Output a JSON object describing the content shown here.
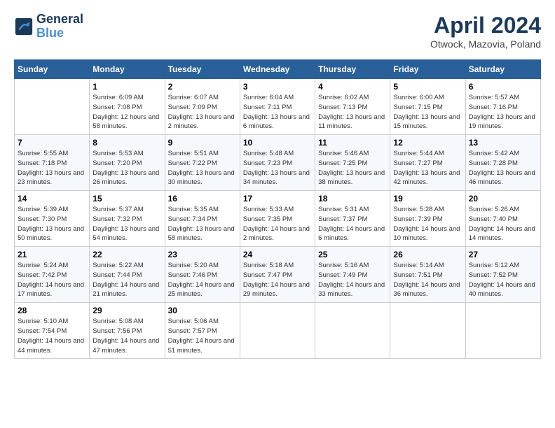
{
  "header": {
    "logo_line1": "General",
    "logo_line2": "Blue",
    "month": "April 2024",
    "location": "Otwock, Mazovia, Poland"
  },
  "days_of_week": [
    "Sunday",
    "Monday",
    "Tuesday",
    "Wednesday",
    "Thursday",
    "Friday",
    "Saturday"
  ],
  "weeks": [
    [
      {
        "day": "",
        "sunrise": "",
        "sunset": "",
        "daylight": ""
      },
      {
        "day": "1",
        "sunrise": "6:09 AM",
        "sunset": "7:08 PM",
        "daylight": "12 hours and 58 minutes."
      },
      {
        "day": "2",
        "sunrise": "6:07 AM",
        "sunset": "7:09 PM",
        "daylight": "13 hours and 2 minutes."
      },
      {
        "day": "3",
        "sunrise": "6:04 AM",
        "sunset": "7:11 PM",
        "daylight": "13 hours and 6 minutes."
      },
      {
        "day": "4",
        "sunrise": "6:02 AM",
        "sunset": "7:13 PM",
        "daylight": "13 hours and 11 minutes."
      },
      {
        "day": "5",
        "sunrise": "6:00 AM",
        "sunset": "7:15 PM",
        "daylight": "13 hours and 15 minutes."
      },
      {
        "day": "6",
        "sunrise": "5:57 AM",
        "sunset": "7:16 PM",
        "daylight": "13 hours and 19 minutes."
      }
    ],
    [
      {
        "day": "7",
        "sunrise": "5:55 AM",
        "sunset": "7:18 PM",
        "daylight": "13 hours and 23 minutes."
      },
      {
        "day": "8",
        "sunrise": "5:53 AM",
        "sunset": "7:20 PM",
        "daylight": "13 hours and 26 minutes."
      },
      {
        "day": "9",
        "sunrise": "5:51 AM",
        "sunset": "7:22 PM",
        "daylight": "13 hours and 30 minutes."
      },
      {
        "day": "10",
        "sunrise": "5:48 AM",
        "sunset": "7:23 PM",
        "daylight": "13 hours and 34 minutes."
      },
      {
        "day": "11",
        "sunrise": "5:46 AM",
        "sunset": "7:25 PM",
        "daylight": "13 hours and 38 minutes."
      },
      {
        "day": "12",
        "sunrise": "5:44 AM",
        "sunset": "7:27 PM",
        "daylight": "13 hours and 42 minutes."
      },
      {
        "day": "13",
        "sunrise": "5:42 AM",
        "sunset": "7:28 PM",
        "daylight": "13 hours and 46 minutes."
      }
    ],
    [
      {
        "day": "14",
        "sunrise": "5:39 AM",
        "sunset": "7:30 PM",
        "daylight": "13 hours and 50 minutes."
      },
      {
        "day": "15",
        "sunrise": "5:37 AM",
        "sunset": "7:32 PM",
        "daylight": "13 hours and 54 minutes."
      },
      {
        "day": "16",
        "sunrise": "5:35 AM",
        "sunset": "7:34 PM",
        "daylight": "13 hours and 58 minutes."
      },
      {
        "day": "17",
        "sunrise": "5:33 AM",
        "sunset": "7:35 PM",
        "daylight": "14 hours and 2 minutes."
      },
      {
        "day": "18",
        "sunrise": "5:31 AM",
        "sunset": "7:37 PM",
        "daylight": "14 hours and 6 minutes."
      },
      {
        "day": "19",
        "sunrise": "5:28 AM",
        "sunset": "7:39 PM",
        "daylight": "14 hours and 10 minutes."
      },
      {
        "day": "20",
        "sunrise": "5:26 AM",
        "sunset": "7:40 PM",
        "daylight": "14 hours and 14 minutes."
      }
    ],
    [
      {
        "day": "21",
        "sunrise": "5:24 AM",
        "sunset": "7:42 PM",
        "daylight": "14 hours and 17 minutes."
      },
      {
        "day": "22",
        "sunrise": "5:22 AM",
        "sunset": "7:44 PM",
        "daylight": "14 hours and 21 minutes."
      },
      {
        "day": "23",
        "sunrise": "5:20 AM",
        "sunset": "7:46 PM",
        "daylight": "14 hours and 25 minutes."
      },
      {
        "day": "24",
        "sunrise": "5:18 AM",
        "sunset": "7:47 PM",
        "daylight": "14 hours and 29 minutes."
      },
      {
        "day": "25",
        "sunrise": "5:16 AM",
        "sunset": "7:49 PM",
        "daylight": "14 hours and 33 minutes."
      },
      {
        "day": "26",
        "sunrise": "5:14 AM",
        "sunset": "7:51 PM",
        "daylight": "14 hours and 36 minutes."
      },
      {
        "day": "27",
        "sunrise": "5:12 AM",
        "sunset": "7:52 PM",
        "daylight": "14 hours and 40 minutes."
      }
    ],
    [
      {
        "day": "28",
        "sunrise": "5:10 AM",
        "sunset": "7:54 PM",
        "daylight": "14 hours and 44 minutes."
      },
      {
        "day": "29",
        "sunrise": "5:08 AM",
        "sunset": "7:56 PM",
        "daylight": "14 hours and 47 minutes."
      },
      {
        "day": "30",
        "sunrise": "5:06 AM",
        "sunset": "7:57 PM",
        "daylight": "14 hours and 51 minutes."
      },
      {
        "day": "",
        "sunrise": "",
        "sunset": "",
        "daylight": ""
      },
      {
        "day": "",
        "sunrise": "",
        "sunset": "",
        "daylight": ""
      },
      {
        "day": "",
        "sunrise": "",
        "sunset": "",
        "daylight": ""
      },
      {
        "day": "",
        "sunrise": "",
        "sunset": "",
        "daylight": ""
      }
    ]
  ]
}
